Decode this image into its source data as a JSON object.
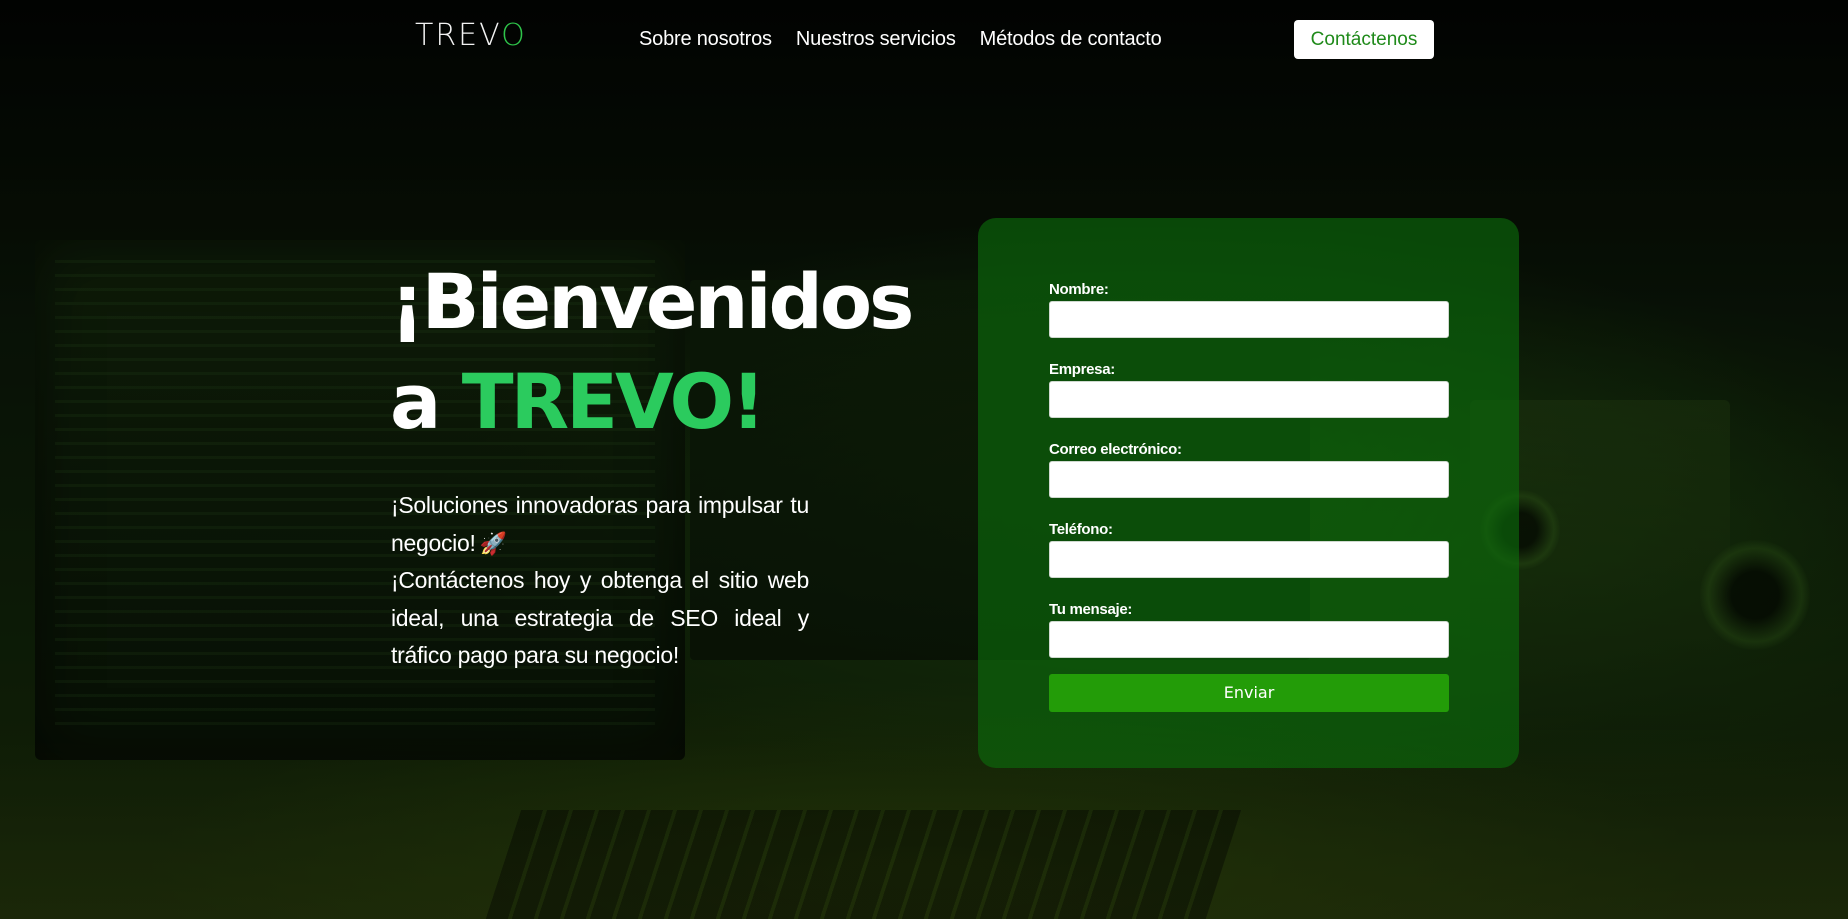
{
  "header": {
    "logo_main": "TREV",
    "logo_accent": "O",
    "nav": [
      {
        "label": "Sobre nosotros"
      },
      {
        "label": "Nuestros servicios"
      },
      {
        "label": "Métodos de contacto"
      }
    ],
    "cta_label": "Contáctenos"
  },
  "hero": {
    "title_line1": "¡Bienvenidos",
    "title_prefix": "a ",
    "title_accent": "TREVO!",
    "text_line1": "¡Soluciones innovadoras para impulsar tu negocio!",
    "rocket_emoji": "🚀",
    "text_line2": "¡Contáctenos hoy y obtenga el sitio web ideal, una estrategia de SEO ideal y tráfico pago para su negocio!"
  },
  "form": {
    "fields": [
      {
        "label": "Nombre:",
        "value": ""
      },
      {
        "label": "Empresa:",
        "value": ""
      },
      {
        "label": "Correo electrónico:",
        "value": ""
      },
      {
        "label": "Teléfono:",
        "value": ""
      },
      {
        "label": "Tu mensaje:",
        "value": ""
      }
    ],
    "submit_label": "Enviar"
  },
  "colors": {
    "accent_green": "#2bcb5e",
    "button_green": "#239c08",
    "card_green": "#0c6e0c"
  },
  "icons": {
    "background": "desk-computer-photo",
    "rocket": "rocket-icon"
  }
}
